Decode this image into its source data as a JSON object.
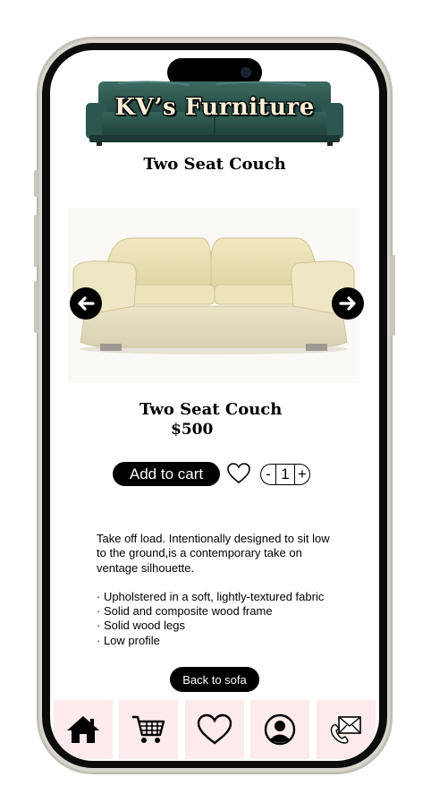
{
  "app": {
    "brand_name": "KV’s Furniture",
    "page_title": "Two Seat Couch"
  },
  "product": {
    "name": "Two Seat Couch",
    "price": "$500",
    "image_icon": "sofa-photo",
    "carousel": {
      "prev_icon": "arrow-left-circle-icon",
      "next_icon": "arrow-right-circle-icon"
    }
  },
  "actions": {
    "add_to_cart_label": "Add to cart",
    "favorite_icon": "heart-outline-icon",
    "quantity": {
      "minus_label": "-",
      "value": "1",
      "plus_label": "+"
    },
    "back_label": "Back to sofa"
  },
  "description": {
    "intro": "Take off load. Intentionally designed to sit low to the ground,is a contemporary take  on ventage silhouette.",
    "bullets": [
      "· Upholstered in a soft, lightly-textured fabric",
      "· Solid and composite wood frame",
      "· Solid wood legs",
      "· Low profile"
    ]
  },
  "bottom_nav": {
    "items": [
      {
        "icon": "home-icon"
      },
      {
        "icon": "cart-icon"
      },
      {
        "icon": "heart-icon"
      },
      {
        "icon": "user-profile-icon"
      },
      {
        "icon": "contact-phone-mail-icon"
      }
    ],
    "tile_color": "#fdeaea"
  },
  "colors": {
    "button_bg": "#000000",
    "button_text": "#ffffff",
    "logo_sofa": "#2f5e57",
    "couch": "#e8e0b0"
  }
}
